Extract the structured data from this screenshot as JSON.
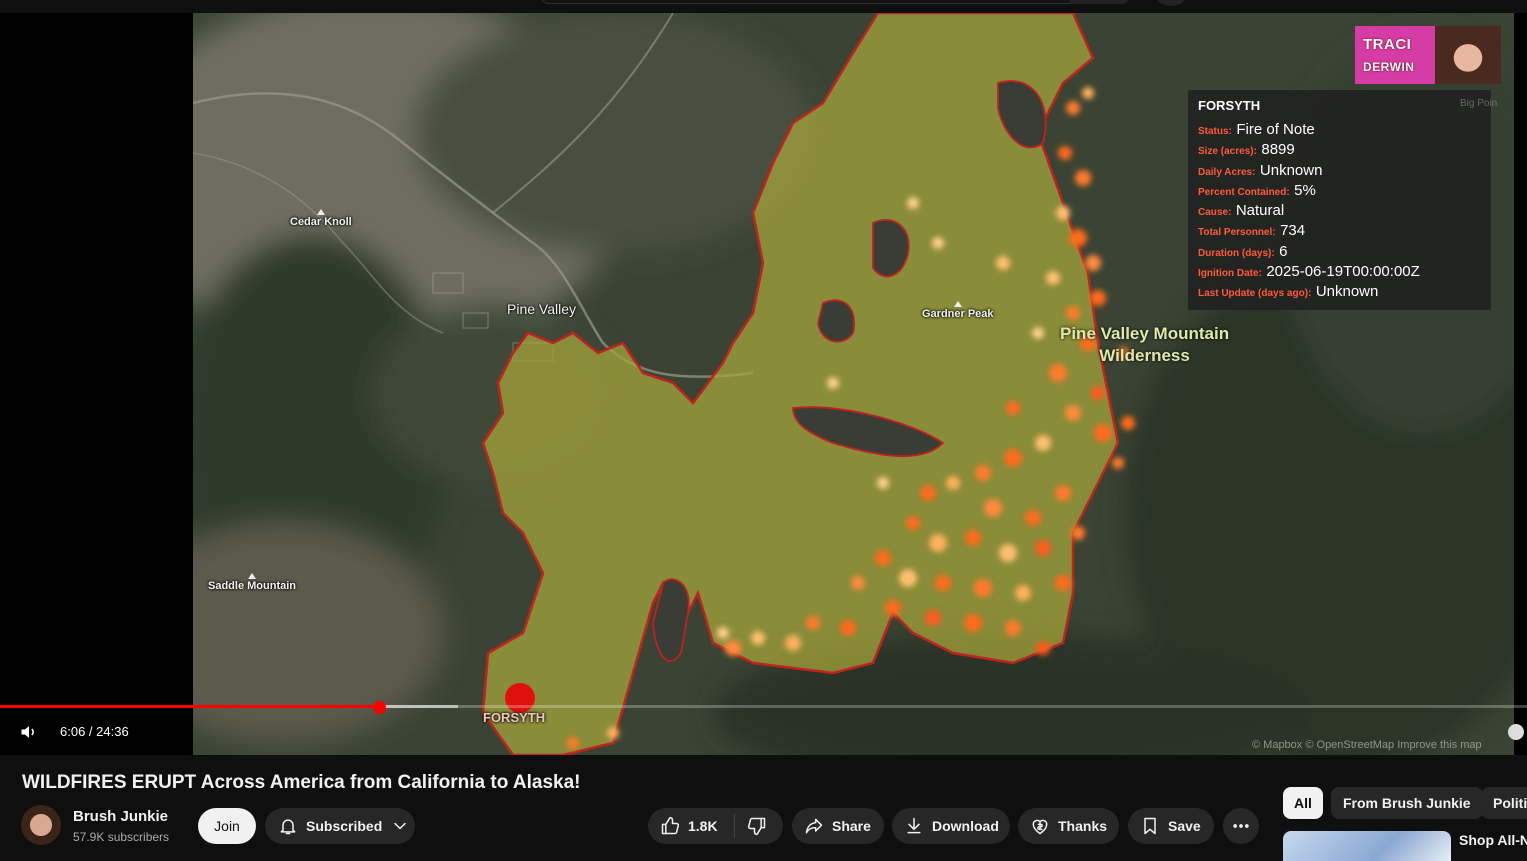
{
  "video": {
    "current_time": "6:06",
    "duration": "24:36",
    "time_display": "6:06 / 24:36",
    "progress_fraction": 0.248,
    "buffered_fraction": 0.3,
    "map_labels": {
      "cedar_knoll": "Cedar Knoll",
      "pine_valley": "Pine Valley",
      "gardner_peak": "Gardner Peak",
      "saddle_mountain": "Saddle Mountain",
      "wilderness_line1": "Pine Valley Mountain",
      "wilderness_line2": "Wilderness",
      "fire_marker": "FORSYTH",
      "attribution": "© Mapbox © OpenStreetMap  Improve this map",
      "big_point": "Big Poin"
    },
    "host_badge": {
      "line1": "TRACI",
      "line2": "DERWIN"
    },
    "info_card": {
      "title": "FORSYTH",
      "rows": [
        {
          "key": "Status:",
          "value": "Fire of Note"
        },
        {
          "key": "Size (acres):",
          "value": "8899"
        },
        {
          "key": "Daily Acres:",
          "value": "Unknown"
        },
        {
          "key": "Percent Contained:",
          "value": "5%"
        },
        {
          "key": "Cause:",
          "value": "Natural"
        },
        {
          "key": "Total Personnel:",
          "value": "734"
        },
        {
          "key": "Duration (days):",
          "value": "6"
        },
        {
          "key": "Ignition Date:",
          "value": "2025-06-19T00:00:00Z"
        },
        {
          "key": "Last Update (days ago):",
          "value": "Unknown"
        }
      ]
    }
  },
  "meta": {
    "title": "WILDFIRES ERUPT Across America from California to Alaska!",
    "channel_name": "Brush Junkie",
    "subscribers": "57.9K subscribers",
    "join_label": "Join",
    "subscribed_label": "Subscribed",
    "like_count": "1.8K",
    "share_label": "Share",
    "download_label": "Download",
    "thanks_label": "Thanks",
    "save_label": "Save"
  },
  "sidebar": {
    "chips": [
      "All",
      "From Brush Junkie",
      "Politi"
    ],
    "active_chip": "All",
    "recommendation_title": "Shop All-Ne"
  },
  "colors": {
    "accent": "#ff0000",
    "burn_area": "#a8a83a",
    "burn_outline": "#c0221e",
    "hotspot": "#ff6a1a",
    "info_key": "#ff5a3c",
    "host_badge": "#d63ca5"
  }
}
